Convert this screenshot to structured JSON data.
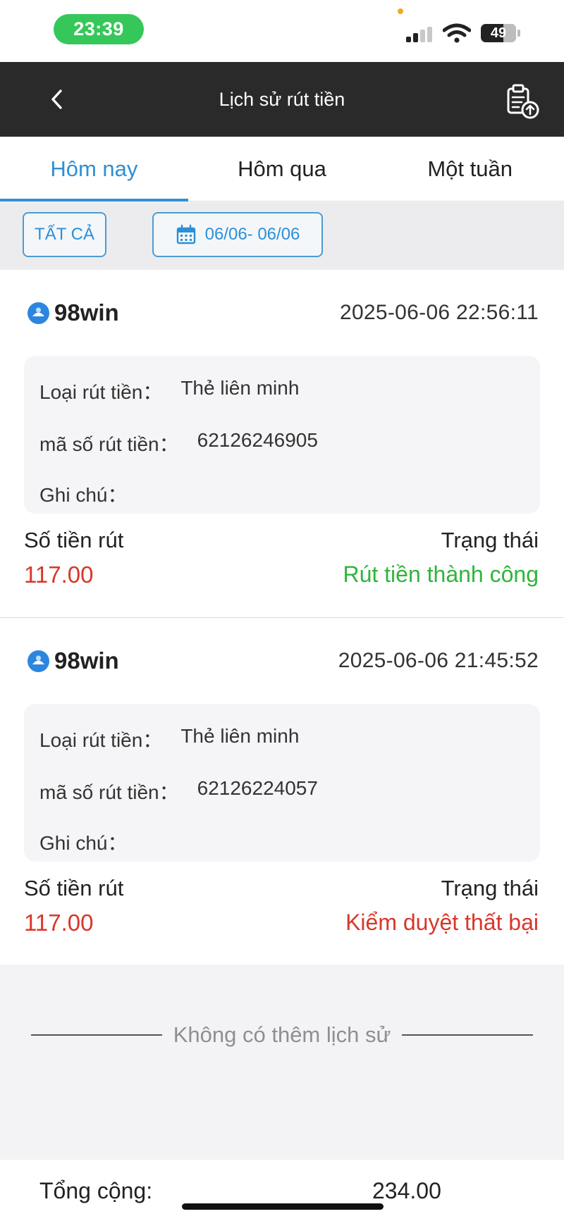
{
  "status_bar": {
    "time": "23:39",
    "battery": "49",
    "accent_color": "#35c759"
  },
  "header": {
    "title": "Lịch sử rút tiền",
    "back_icon": "chevron-left-icon",
    "export_icon": "clipboard-upload-icon"
  },
  "tabs": [
    {
      "label": "Hôm nay",
      "active": true
    },
    {
      "label": "Hôm qua",
      "active": false
    },
    {
      "label": "Một tuần",
      "active": false
    }
  ],
  "filters": {
    "all_label": "TẤT CẢ",
    "date_range": "06/06- 06/06",
    "calendar_icon": "calendar-icon"
  },
  "labels": {
    "type": "Loại rút tiền：",
    "code": "mã số rút tiền：",
    "note": "Ghi chú：",
    "amount": "Số tiền rút",
    "status": "Trạng thái"
  },
  "records": [
    {
      "brand": "98win",
      "time": "2025-06-06 22:56:11",
      "type_value": "Thẻ liên minh",
      "code_value": "62126246905",
      "note_value": "",
      "amount": "117.00",
      "status": "Rút tiền thành công",
      "status_color": "#2fb53b"
    },
    {
      "brand": "98win",
      "time": "2025-06-06 21:45:52",
      "type_value": "Thẻ liên minh",
      "code_value": "62126224057",
      "note_value": "",
      "amount": "117.00",
      "status": "Kiểm duyệt thất bại",
      "status_color": "#d9362b"
    }
  ],
  "end_of_list": "Không có thêm lịch sử",
  "footer": {
    "total_label": "Tổng cộng:",
    "total_value": "234.00"
  },
  "colors": {
    "primary": "#2d8fd6",
    "header_bg": "#2a2a2a",
    "amount": "#d9362b"
  }
}
